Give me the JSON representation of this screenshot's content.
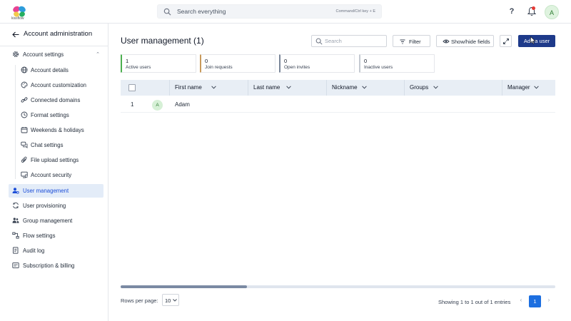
{
  "app": {
    "logo_text": "kissflow"
  },
  "topbar": {
    "search_placeholder": "Search everything",
    "search_shortcut": "Command/Ctrl key + E",
    "help_label": "?",
    "avatar_initial": "A"
  },
  "sidebar": {
    "back_title": "Account administration",
    "section": {
      "label": "Account settings",
      "expanded": true
    },
    "sub_items": [
      {
        "label": "Account details",
        "icon": "globe-icon"
      },
      {
        "label": "Account customization",
        "icon": "palette-icon"
      },
      {
        "label": "Connected domains",
        "icon": "link-icon"
      },
      {
        "label": "Format settings",
        "icon": "clock-icon"
      },
      {
        "label": "Weekends & holidays",
        "icon": "calendar-icon"
      },
      {
        "label": "Chat settings",
        "icon": "chat-icon"
      },
      {
        "label": "File upload settings",
        "icon": "paperclip-icon"
      },
      {
        "label": "Account security",
        "icon": "shield-monitor-icon"
      }
    ],
    "items": [
      {
        "label": "User management",
        "icon": "user-gear-icon",
        "active": true
      },
      {
        "label": "User provisioning",
        "icon": "sync-icon"
      },
      {
        "label": "Group management",
        "icon": "group-icon"
      },
      {
        "label": "Flow settings",
        "icon": "flow-icon"
      },
      {
        "label": "Audit log",
        "icon": "audit-log-icon"
      },
      {
        "label": "Subscription & billing",
        "icon": "billing-icon"
      }
    ]
  },
  "main": {
    "title": "User management (1)",
    "search_placeholder": "Search",
    "filter_label": "Filter",
    "show_hide_label": "Show/hide fields",
    "add_user_label": "Add a user",
    "stats": [
      {
        "count": "1",
        "caption": "Active users",
        "color": "#4caf50"
      },
      {
        "count": "0",
        "caption": "Join requests",
        "color": "#c99a5b"
      },
      {
        "count": "0",
        "caption": "Open invites",
        "color": "#7a8699"
      },
      {
        "count": "0",
        "caption": "Inactive users",
        "color": "#c4c9d1"
      }
    ],
    "table": {
      "columns": [
        "First name",
        "Last name",
        "Nickname",
        "Groups",
        "Manager"
      ],
      "rows": [
        {
          "index": "1",
          "avatar": "A",
          "first_name": "Adam"
        }
      ]
    },
    "scroll_fraction": 0.29,
    "pagination": {
      "rows_per_page_label": "Rows per page:",
      "rows_per_page": "10",
      "showing": "Showing 1 to 1 out of 1 entries",
      "current_page": "1"
    }
  },
  "colors": {
    "accent": "#1e3a8a",
    "active_bg": "#e3ecf8",
    "page_button": "#1d6fe0"
  }
}
